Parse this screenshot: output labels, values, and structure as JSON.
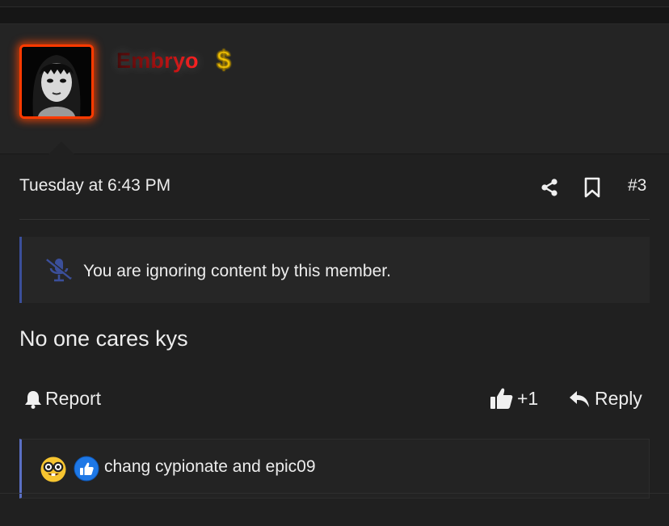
{
  "post": {
    "username": "Embryo",
    "banner_icon": "dollar-sign-icon",
    "timestamp": "Tuesday at 6:43 PM",
    "number": "#3",
    "ignore_notice": "You are ignoring content by this member.",
    "body": "No one cares kys",
    "actions": {
      "report": "Report",
      "like_count": "+1",
      "reply": "Reply"
    },
    "reactions": {
      "icons": [
        "nerd-face-icon",
        "thumbs-up-badge-icon"
      ],
      "text": "chang cypionate and epic09"
    }
  },
  "colors": {
    "background": "#1b1b1b",
    "post_bg": "#202020",
    "avatar_border": "#ff3a00",
    "ignore_accent": "#3b4f9a",
    "reaction_accent": "#5a6fc4",
    "username_gradient_end": "#ff1a1a"
  }
}
